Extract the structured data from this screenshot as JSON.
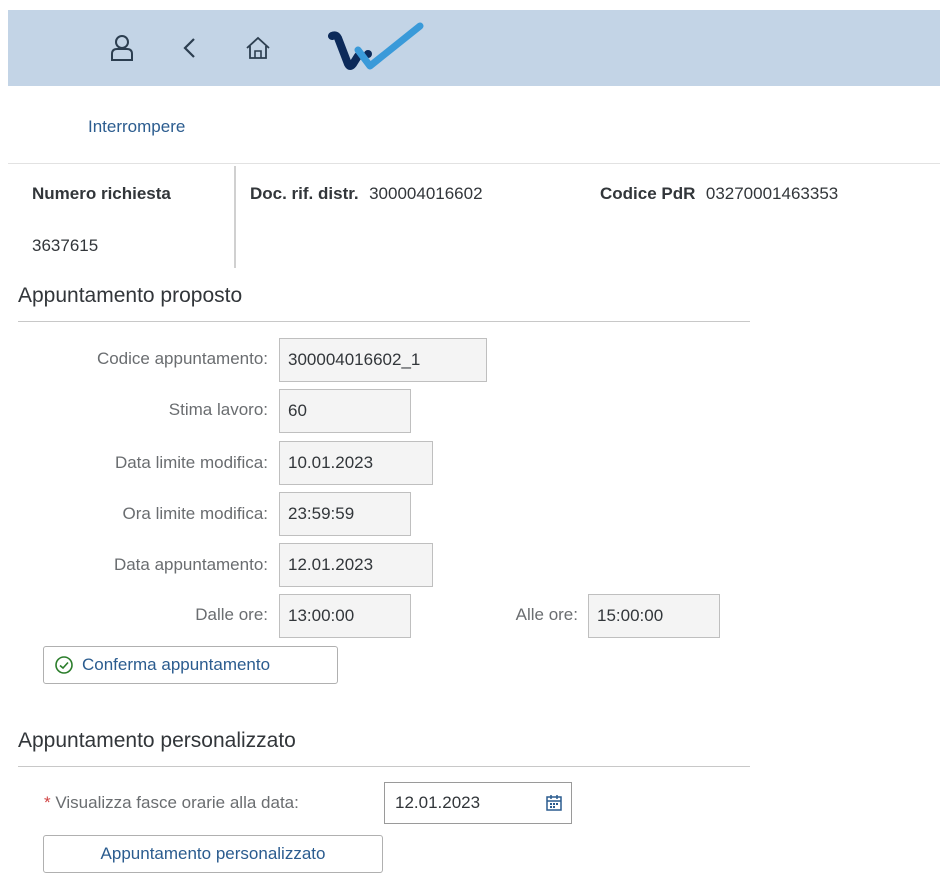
{
  "shell": {
    "icons": [
      "user-icon",
      "back-icon",
      "home-icon"
    ],
    "colors": {
      "shellbar": "#c3d4e6",
      "logo_dark": "#0c2a5a",
      "logo_light": "#3a9ad9"
    }
  },
  "toolbar": {
    "cancel_label": "Interrompere"
  },
  "header": {
    "request_number_label": "Numero richiesta",
    "request_number_value": "3637615",
    "doc_ref_label": "Doc. rif. distr.",
    "doc_ref_value": "300004016602",
    "pdr_label": "Codice PdR",
    "pdr_value": "03270001463353"
  },
  "proposed": {
    "title": "Appuntamento proposto",
    "fields": {
      "code_label": "Codice appuntamento:",
      "code_value": "300004016602_1",
      "estimate_label": "Stima lavoro:",
      "estimate_value": "60",
      "deadline_date_label": "Data limite modifica:",
      "deadline_date_value": "10.01.2023",
      "deadline_time_label": "Ora limite modifica:",
      "deadline_time_value": "23:59:59",
      "appt_date_label": "Data appuntamento:",
      "appt_date_value": "12.01.2023",
      "from_label": "Dalle ore:",
      "from_value": "13:00:00",
      "to_label": "Alle ore:",
      "to_value": "15:00:00"
    },
    "confirm_button": "Conferma appuntamento"
  },
  "custom": {
    "title": "Appuntamento personalizzato",
    "required_marker": "*",
    "date_label": "Visualizza fasce orarie alla data:",
    "date_value": "12.01.2023",
    "button": "Appuntamento personalizzato"
  }
}
